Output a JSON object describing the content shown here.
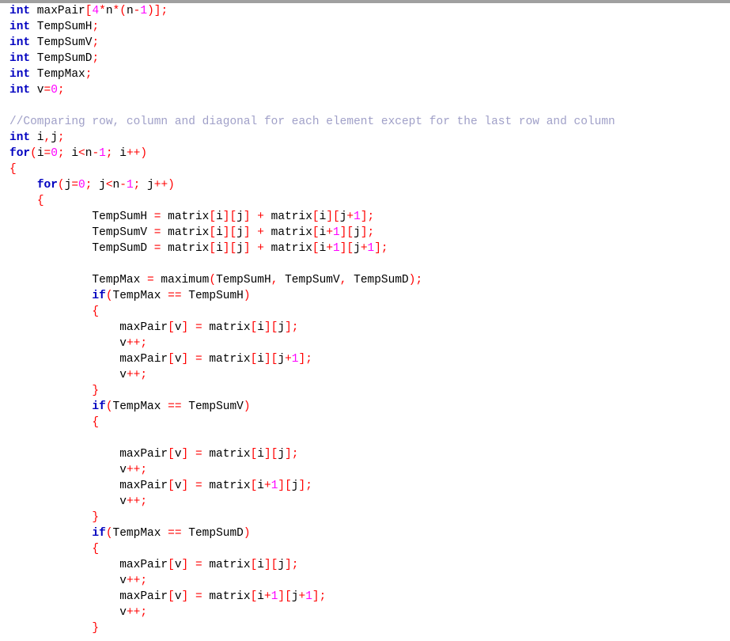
{
  "colors": {
    "keyword": "#0000c0",
    "identifier": "#000000",
    "operator": "#ff0000",
    "number": "#ff00ff",
    "comment": "#a0a0c8",
    "background": "#ffffff"
  },
  "code_lines": [
    [
      [
        "kw",
        "int"
      ],
      [
        "id",
        " maxPair"
      ],
      [
        "op",
        "["
      ],
      [
        "num",
        "4"
      ],
      [
        "op",
        "*"
      ],
      [
        "id",
        "n"
      ],
      [
        "op",
        "*("
      ],
      [
        "id",
        "n"
      ],
      [
        "op",
        "-"
      ],
      [
        "num",
        "1"
      ],
      [
        "op",
        ")];"
      ]
    ],
    [
      [
        "kw",
        "int"
      ],
      [
        "id",
        " TempSumH"
      ],
      [
        "op",
        ";"
      ]
    ],
    [
      [
        "kw",
        "int"
      ],
      [
        "id",
        " TempSumV"
      ],
      [
        "op",
        ";"
      ]
    ],
    [
      [
        "kw",
        "int"
      ],
      [
        "id",
        " TempSumD"
      ],
      [
        "op",
        ";"
      ]
    ],
    [
      [
        "kw",
        "int"
      ],
      [
        "id",
        " TempMax"
      ],
      [
        "op",
        ";"
      ]
    ],
    [
      [
        "kw",
        "int"
      ],
      [
        "id",
        " v"
      ],
      [
        "op",
        "="
      ],
      [
        "num",
        "0"
      ],
      [
        "op",
        ";"
      ]
    ],
    [],
    [
      [
        "cm",
        "//Comparing row, column and diagonal for each element except for the last row and column"
      ]
    ],
    [
      [
        "kw",
        "int"
      ],
      [
        "id",
        " i"
      ],
      [
        "op",
        ","
      ],
      [
        "id",
        "j"
      ],
      [
        "op",
        ";"
      ]
    ],
    [
      [
        "kw",
        "for"
      ],
      [
        "op",
        "("
      ],
      [
        "id",
        "i"
      ],
      [
        "op",
        "="
      ],
      [
        "num",
        "0"
      ],
      [
        "op",
        ";"
      ],
      [
        "id",
        " i"
      ],
      [
        "op",
        "<"
      ],
      [
        "id",
        "n"
      ],
      [
        "op",
        "-"
      ],
      [
        "num",
        "1"
      ],
      [
        "op",
        ";"
      ],
      [
        "id",
        " i"
      ],
      [
        "op",
        "++)"
      ]
    ],
    [
      [
        "op",
        "{"
      ]
    ],
    [
      [
        "id",
        "    "
      ],
      [
        "kw",
        "for"
      ],
      [
        "op",
        "("
      ],
      [
        "id",
        "j"
      ],
      [
        "op",
        "="
      ],
      [
        "num",
        "0"
      ],
      [
        "op",
        ";"
      ],
      [
        "id",
        " j"
      ],
      [
        "op",
        "<"
      ],
      [
        "id",
        "n"
      ],
      [
        "op",
        "-"
      ],
      [
        "num",
        "1"
      ],
      [
        "op",
        ";"
      ],
      [
        "id",
        " j"
      ],
      [
        "op",
        "++)"
      ]
    ],
    [
      [
        "id",
        "    "
      ],
      [
        "op",
        "{"
      ]
    ],
    [
      [
        "id",
        "            TempSumH "
      ],
      [
        "op",
        "="
      ],
      [
        "id",
        " matrix"
      ],
      [
        "op",
        "["
      ],
      [
        "id",
        "i"
      ],
      [
        "op",
        "]["
      ],
      [
        "id",
        "j"
      ],
      [
        "op",
        "]"
      ],
      [
        "id",
        " "
      ],
      [
        "op",
        "+"
      ],
      [
        "id",
        " matrix"
      ],
      [
        "op",
        "["
      ],
      [
        "id",
        "i"
      ],
      [
        "op",
        "]["
      ],
      [
        "id",
        "j"
      ],
      [
        "op",
        "+"
      ],
      [
        "num",
        "1"
      ],
      [
        "op",
        "];"
      ]
    ],
    [
      [
        "id",
        "            TempSumV "
      ],
      [
        "op",
        "="
      ],
      [
        "id",
        " matrix"
      ],
      [
        "op",
        "["
      ],
      [
        "id",
        "i"
      ],
      [
        "op",
        "]["
      ],
      [
        "id",
        "j"
      ],
      [
        "op",
        "]"
      ],
      [
        "id",
        " "
      ],
      [
        "op",
        "+"
      ],
      [
        "id",
        " matrix"
      ],
      [
        "op",
        "["
      ],
      [
        "id",
        "i"
      ],
      [
        "op",
        "+"
      ],
      [
        "num",
        "1"
      ],
      [
        "op",
        "]["
      ],
      [
        "id",
        "j"
      ],
      [
        "op",
        "];"
      ]
    ],
    [
      [
        "id",
        "            TempSumD "
      ],
      [
        "op",
        "="
      ],
      [
        "id",
        " matrix"
      ],
      [
        "op",
        "["
      ],
      [
        "id",
        "i"
      ],
      [
        "op",
        "]["
      ],
      [
        "id",
        "j"
      ],
      [
        "op",
        "]"
      ],
      [
        "id",
        " "
      ],
      [
        "op",
        "+"
      ],
      [
        "id",
        " matrix"
      ],
      [
        "op",
        "["
      ],
      [
        "id",
        "i"
      ],
      [
        "op",
        "+"
      ],
      [
        "num",
        "1"
      ],
      [
        "op",
        "]["
      ],
      [
        "id",
        "j"
      ],
      [
        "op",
        "+"
      ],
      [
        "num",
        "1"
      ],
      [
        "op",
        "];"
      ]
    ],
    [],
    [
      [
        "id",
        "            TempMax "
      ],
      [
        "op",
        "="
      ],
      [
        "id",
        " maximum"
      ],
      [
        "op",
        "("
      ],
      [
        "id",
        "TempSumH"
      ],
      [
        "op",
        ","
      ],
      [
        "id",
        " TempSumV"
      ],
      [
        "op",
        ","
      ],
      [
        "id",
        " TempSumD"
      ],
      [
        "op",
        ");"
      ]
    ],
    [
      [
        "id",
        "            "
      ],
      [
        "kw",
        "if"
      ],
      [
        "op",
        "("
      ],
      [
        "id",
        "TempMax "
      ],
      [
        "op",
        "=="
      ],
      [
        "id",
        " TempSumH"
      ],
      [
        "op",
        ")"
      ]
    ],
    [
      [
        "id",
        "            "
      ],
      [
        "op",
        "{"
      ]
    ],
    [
      [
        "id",
        "                maxPair"
      ],
      [
        "op",
        "["
      ],
      [
        "id",
        "v"
      ],
      [
        "op",
        "]"
      ],
      [
        "id",
        " "
      ],
      [
        "op",
        "="
      ],
      [
        "id",
        " matrix"
      ],
      [
        "op",
        "["
      ],
      [
        "id",
        "i"
      ],
      [
        "op",
        "]["
      ],
      [
        "id",
        "j"
      ],
      [
        "op",
        "];"
      ]
    ],
    [
      [
        "id",
        "                v"
      ],
      [
        "op",
        "++;"
      ]
    ],
    [
      [
        "id",
        "                maxPair"
      ],
      [
        "op",
        "["
      ],
      [
        "id",
        "v"
      ],
      [
        "op",
        "]"
      ],
      [
        "id",
        " "
      ],
      [
        "op",
        "="
      ],
      [
        "id",
        " matrix"
      ],
      [
        "op",
        "["
      ],
      [
        "id",
        "i"
      ],
      [
        "op",
        "]["
      ],
      [
        "id",
        "j"
      ],
      [
        "op",
        "+"
      ],
      [
        "num",
        "1"
      ],
      [
        "op",
        "];"
      ]
    ],
    [
      [
        "id",
        "                v"
      ],
      [
        "op",
        "++;"
      ]
    ],
    [
      [
        "id",
        "            "
      ],
      [
        "op",
        "}"
      ]
    ],
    [
      [
        "id",
        "            "
      ],
      [
        "kw",
        "if"
      ],
      [
        "op",
        "("
      ],
      [
        "id",
        "TempMax "
      ],
      [
        "op",
        "=="
      ],
      [
        "id",
        " TempSumV"
      ],
      [
        "op",
        ")"
      ]
    ],
    [
      [
        "id",
        "            "
      ],
      [
        "op",
        "{"
      ]
    ],
    [],
    [
      [
        "id",
        "                maxPair"
      ],
      [
        "op",
        "["
      ],
      [
        "id",
        "v"
      ],
      [
        "op",
        "]"
      ],
      [
        "id",
        " "
      ],
      [
        "op",
        "="
      ],
      [
        "id",
        " matrix"
      ],
      [
        "op",
        "["
      ],
      [
        "id",
        "i"
      ],
      [
        "op",
        "]["
      ],
      [
        "id",
        "j"
      ],
      [
        "op",
        "];"
      ]
    ],
    [
      [
        "id",
        "                v"
      ],
      [
        "op",
        "++;"
      ]
    ],
    [
      [
        "id",
        "                maxPair"
      ],
      [
        "op",
        "["
      ],
      [
        "id",
        "v"
      ],
      [
        "op",
        "]"
      ],
      [
        "id",
        " "
      ],
      [
        "op",
        "="
      ],
      [
        "id",
        " matrix"
      ],
      [
        "op",
        "["
      ],
      [
        "id",
        "i"
      ],
      [
        "op",
        "+"
      ],
      [
        "num",
        "1"
      ],
      [
        "op",
        "]["
      ],
      [
        "id",
        "j"
      ],
      [
        "op",
        "];"
      ]
    ],
    [
      [
        "id",
        "                v"
      ],
      [
        "op",
        "++;"
      ]
    ],
    [
      [
        "id",
        "            "
      ],
      [
        "op",
        "}"
      ]
    ],
    [
      [
        "id",
        "            "
      ],
      [
        "kw",
        "if"
      ],
      [
        "op",
        "("
      ],
      [
        "id",
        "TempMax "
      ],
      [
        "op",
        "=="
      ],
      [
        "id",
        " TempSumD"
      ],
      [
        "op",
        ")"
      ]
    ],
    [
      [
        "id",
        "            "
      ],
      [
        "op",
        "{"
      ]
    ],
    [
      [
        "id",
        "                maxPair"
      ],
      [
        "op",
        "["
      ],
      [
        "id",
        "v"
      ],
      [
        "op",
        "]"
      ],
      [
        "id",
        " "
      ],
      [
        "op",
        "="
      ],
      [
        "id",
        " matrix"
      ],
      [
        "op",
        "["
      ],
      [
        "id",
        "i"
      ],
      [
        "op",
        "]["
      ],
      [
        "id",
        "j"
      ],
      [
        "op",
        "];"
      ]
    ],
    [
      [
        "id",
        "                v"
      ],
      [
        "op",
        "++;"
      ]
    ],
    [
      [
        "id",
        "                maxPair"
      ],
      [
        "op",
        "["
      ],
      [
        "id",
        "v"
      ],
      [
        "op",
        "]"
      ],
      [
        "id",
        " "
      ],
      [
        "op",
        "="
      ],
      [
        "id",
        " matrix"
      ],
      [
        "op",
        "["
      ],
      [
        "id",
        "i"
      ],
      [
        "op",
        "+"
      ],
      [
        "num",
        "1"
      ],
      [
        "op",
        "]["
      ],
      [
        "id",
        "j"
      ],
      [
        "op",
        "+"
      ],
      [
        "num",
        "1"
      ],
      [
        "op",
        "];"
      ]
    ],
    [
      [
        "id",
        "                v"
      ],
      [
        "op",
        "++;"
      ]
    ],
    [
      [
        "id",
        "            "
      ],
      [
        "op",
        "}"
      ]
    ]
  ]
}
